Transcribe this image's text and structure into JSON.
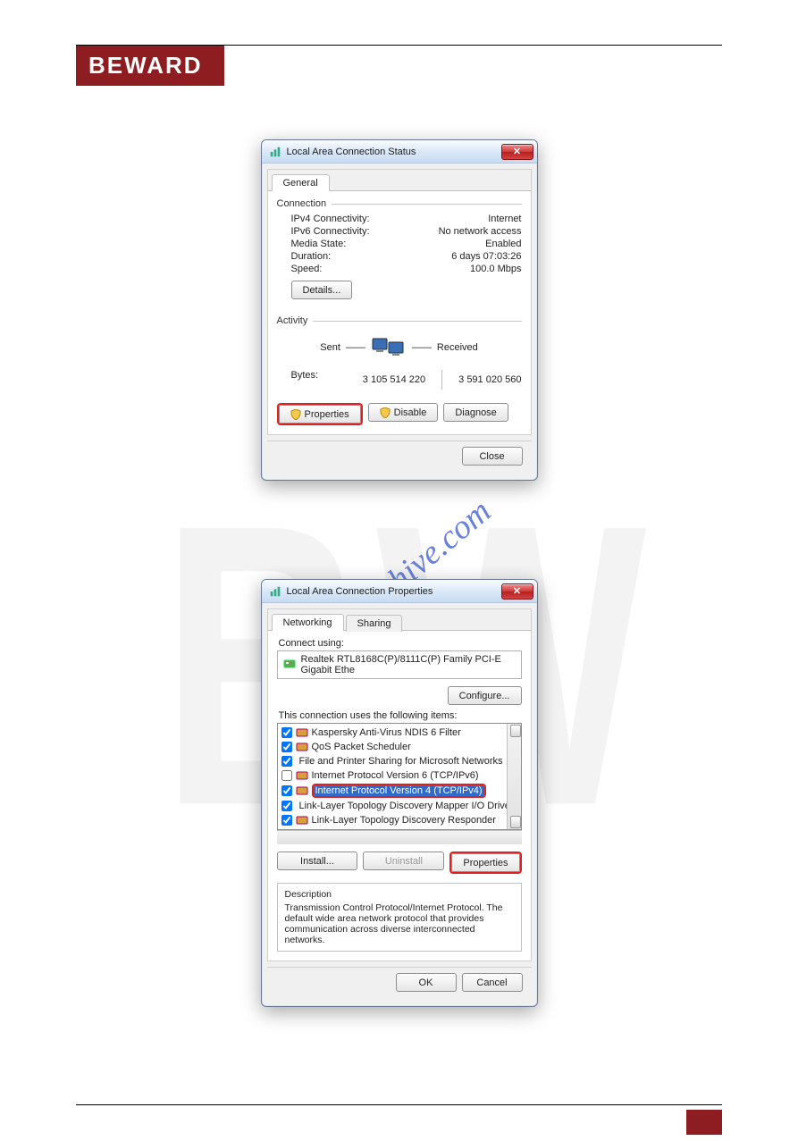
{
  "brand": "BEWARD",
  "watermark_link": "manualshive.com",
  "dialog1": {
    "title": "Local Area Connection Status",
    "tabs": {
      "general": "General"
    },
    "groups": {
      "connection": "Connection",
      "activity": "Activity"
    },
    "rows": {
      "ipv4_label": "IPv4 Connectivity:",
      "ipv4_value": "Internet",
      "ipv6_label": "IPv6 Connectivity:",
      "ipv6_value": "No network access",
      "media_label": "Media State:",
      "media_value": "Enabled",
      "duration_label": "Duration:",
      "duration_value": "6 days 07:03:26",
      "speed_label": "Speed:",
      "speed_value": "100.0 Mbps"
    },
    "details_btn": "Details...",
    "activity": {
      "sent": "Sent",
      "received": "Received",
      "bytes_label": "Bytes:",
      "sent_bytes": "3 105 514 220",
      "recv_bytes": "3 591 020 560"
    },
    "buttons": {
      "properties": "Properties",
      "disable": "Disable",
      "diagnose": "Diagnose",
      "close": "Close"
    }
  },
  "dialog2": {
    "title": "Local Area Connection Properties",
    "tabs": {
      "networking": "Networking",
      "sharing": "Sharing"
    },
    "connect_label": "Connect using:",
    "adapter": "Realtek RTL8168C(P)/8111C(P) Family PCI-E Gigabit Ethe",
    "configure_btn": "Configure...",
    "items_label": "This connection uses the following items:",
    "items": [
      {
        "checked": true,
        "text": "Kaspersky Anti-Virus NDIS 6 Filter"
      },
      {
        "checked": true,
        "text": "QoS Packet Scheduler"
      },
      {
        "checked": true,
        "text": "File and Printer Sharing for Microsoft Networks"
      },
      {
        "checked": false,
        "text": "Internet Protocol Version 6 (TCP/IPv6)"
      },
      {
        "checked": true,
        "text": "Internet Protocol Version 4 (TCP/IPv4)",
        "selected": true
      },
      {
        "checked": true,
        "text": "Link-Layer Topology Discovery Mapper I/O Driver"
      },
      {
        "checked": true,
        "text": "Link-Layer Topology Discovery Responder"
      }
    ],
    "buttons": {
      "install": "Install...",
      "uninstall": "Uninstall",
      "properties": "Properties",
      "ok": "OK",
      "cancel": "Cancel"
    },
    "desc_label": "Description",
    "desc_text": "Transmission Control Protocol/Internet Protocol. The default wide area network protocol that provides communication across diverse interconnected networks."
  }
}
